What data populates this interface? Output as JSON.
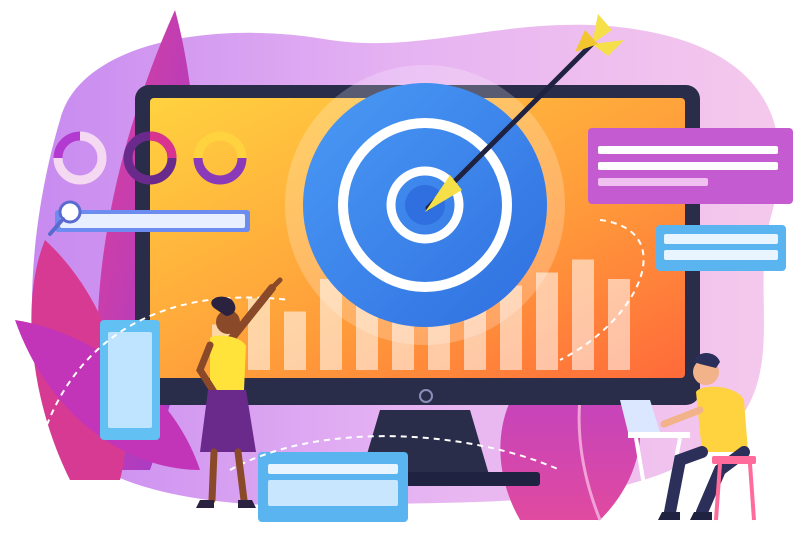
{
  "illustration": {
    "subject": "target-on-monitor",
    "colors": {
      "background": "#ffffff",
      "blob_pink": "#f4c4ec",
      "blob_purple": "#d9a3f0",
      "leaf_magenta": "#d9338f",
      "leaf_purple": "#a63fc9",
      "monitor_frame": "#2a2d4a",
      "screen_yellow": "#ffd23f",
      "screen_orange": "#ff7a2f",
      "target_blue": "#3f8ef0",
      "target_ring": "#ffffff",
      "arrow_tip": "#f5e04a",
      "card_pink": "#d56fd8",
      "card_blue": "#62c0f2",
      "woman_top": "#ffe23a",
      "woman_skirt": "#6a2a8c",
      "man_shirt": "#ffd23f",
      "man_pants": "#2b2f5a",
      "chair": "#ff6b9a",
      "dashed_line": "#ffffff"
    },
    "bars": [
      0.35,
      0.55,
      0.45,
      0.7,
      0.5,
      0.8,
      0.6,
      0.9,
      0.65,
      0.75,
      0.85,
      0.7
    ],
    "icons": [
      "magnifier-icon",
      "donut-chart-icon",
      "target-icon",
      "arrow-icon"
    ]
  }
}
